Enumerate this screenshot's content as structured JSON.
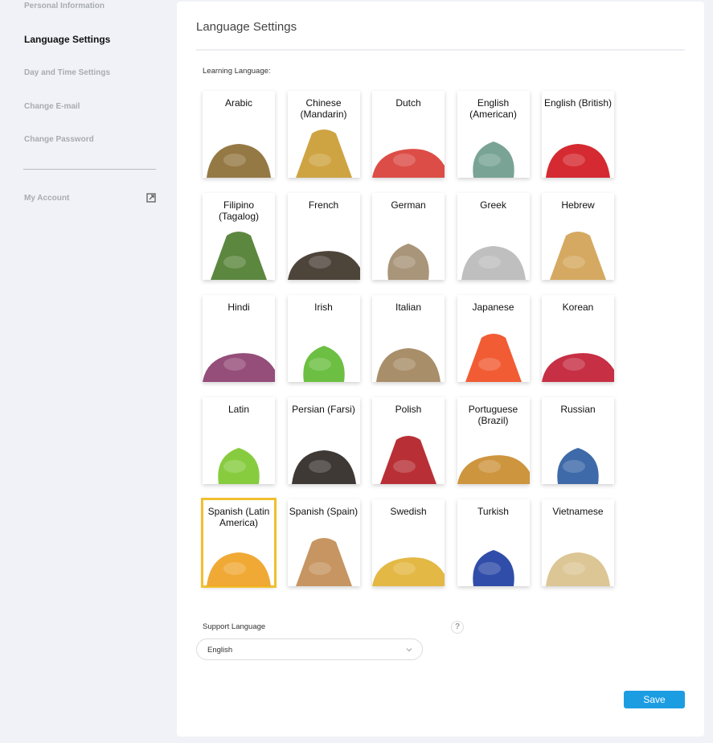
{
  "sidebar": {
    "items": [
      {
        "label": "Personal Information",
        "active": false
      },
      {
        "label": "Language Settings",
        "active": true
      },
      {
        "label": "Day and Time Settings",
        "active": false
      },
      {
        "label": "Change E-mail",
        "active": false
      },
      {
        "label": "Change Password",
        "active": false
      }
    ],
    "account": {
      "label": "My Account",
      "icon": "external-link-icon"
    }
  },
  "panel": {
    "title": "Language Settings",
    "learning_label": "Learning Language:",
    "languages": [
      {
        "name": "Arabic",
        "icon": "magic-lamp",
        "color": "#8a6a30"
      },
      {
        "name": "Chinese (Mandarin)",
        "icon": "dragon",
        "color": "#c99a2e"
      },
      {
        "name": "Dutch",
        "icon": "tulips",
        "color": "#d83a33"
      },
      {
        "name": "English (American)",
        "icon": "statue-of-liberty",
        "color": "#6a9a8a"
      },
      {
        "name": "English (British)",
        "icon": "telephone-box",
        "color": "#d0131b"
      },
      {
        "name": "Filipino (Tagalog)",
        "icon": "palm-tree",
        "color": "#4a7a2a"
      },
      {
        "name": "French",
        "icon": "eiffel-tower",
        "color": "#3a3025"
      },
      {
        "name": "German",
        "icon": "brandenburg-gate",
        "color": "#a08a6a"
      },
      {
        "name": "Greek",
        "icon": "greek-statue",
        "color": "#b8b8b8"
      },
      {
        "name": "Hebrew",
        "icon": "dreidel",
        "color": "#d0a050"
      },
      {
        "name": "Hindi",
        "icon": "elephant",
        "color": "#8a3a6a"
      },
      {
        "name": "Irish",
        "icon": "shamrock",
        "color": "#5cb82e"
      },
      {
        "name": "Italian",
        "icon": "colosseum",
        "color": "#a0825a"
      },
      {
        "name": "Japanese",
        "icon": "gerbera-flower",
        "color": "#f04a1e"
      },
      {
        "name": "Korean",
        "icon": "red-flower",
        "color": "#c01830"
      },
      {
        "name": "Latin",
        "icon": "hot-air-balloon",
        "color": "#7ac62a"
      },
      {
        "name": "Persian (Farsi)",
        "icon": "tea-glasses",
        "color": "#2a2420"
      },
      {
        "name": "Polish",
        "icon": "accordion",
        "color": "#b01a20"
      },
      {
        "name": "Portuguese (Brazil)",
        "icon": "guitar",
        "color": "#c98a2a"
      },
      {
        "name": "Russian",
        "icon": "matryoshka-dolls",
        "color": "#2a5aa0"
      },
      {
        "name": "Spanish (Latin America)",
        "icon": "toucan",
        "color": "#f0a020",
        "selected": true
      },
      {
        "name": "Spanish (Spain)",
        "icon": "castanets",
        "color": "#c08a50"
      },
      {
        "name": "Swedish",
        "icon": "knit-hat",
        "color": "#e0b030"
      },
      {
        "name": "Turkish",
        "icon": "decorative-plate",
        "color": "#1a3aa0"
      },
      {
        "name": "Vietnamese",
        "icon": "conical-hat",
        "color": "#d8c08a"
      }
    ],
    "selected_language": "Spanish (Latin America)",
    "support_label": "Support Language",
    "help_glyph": "?",
    "support_value": "English",
    "save_label": "Save"
  }
}
